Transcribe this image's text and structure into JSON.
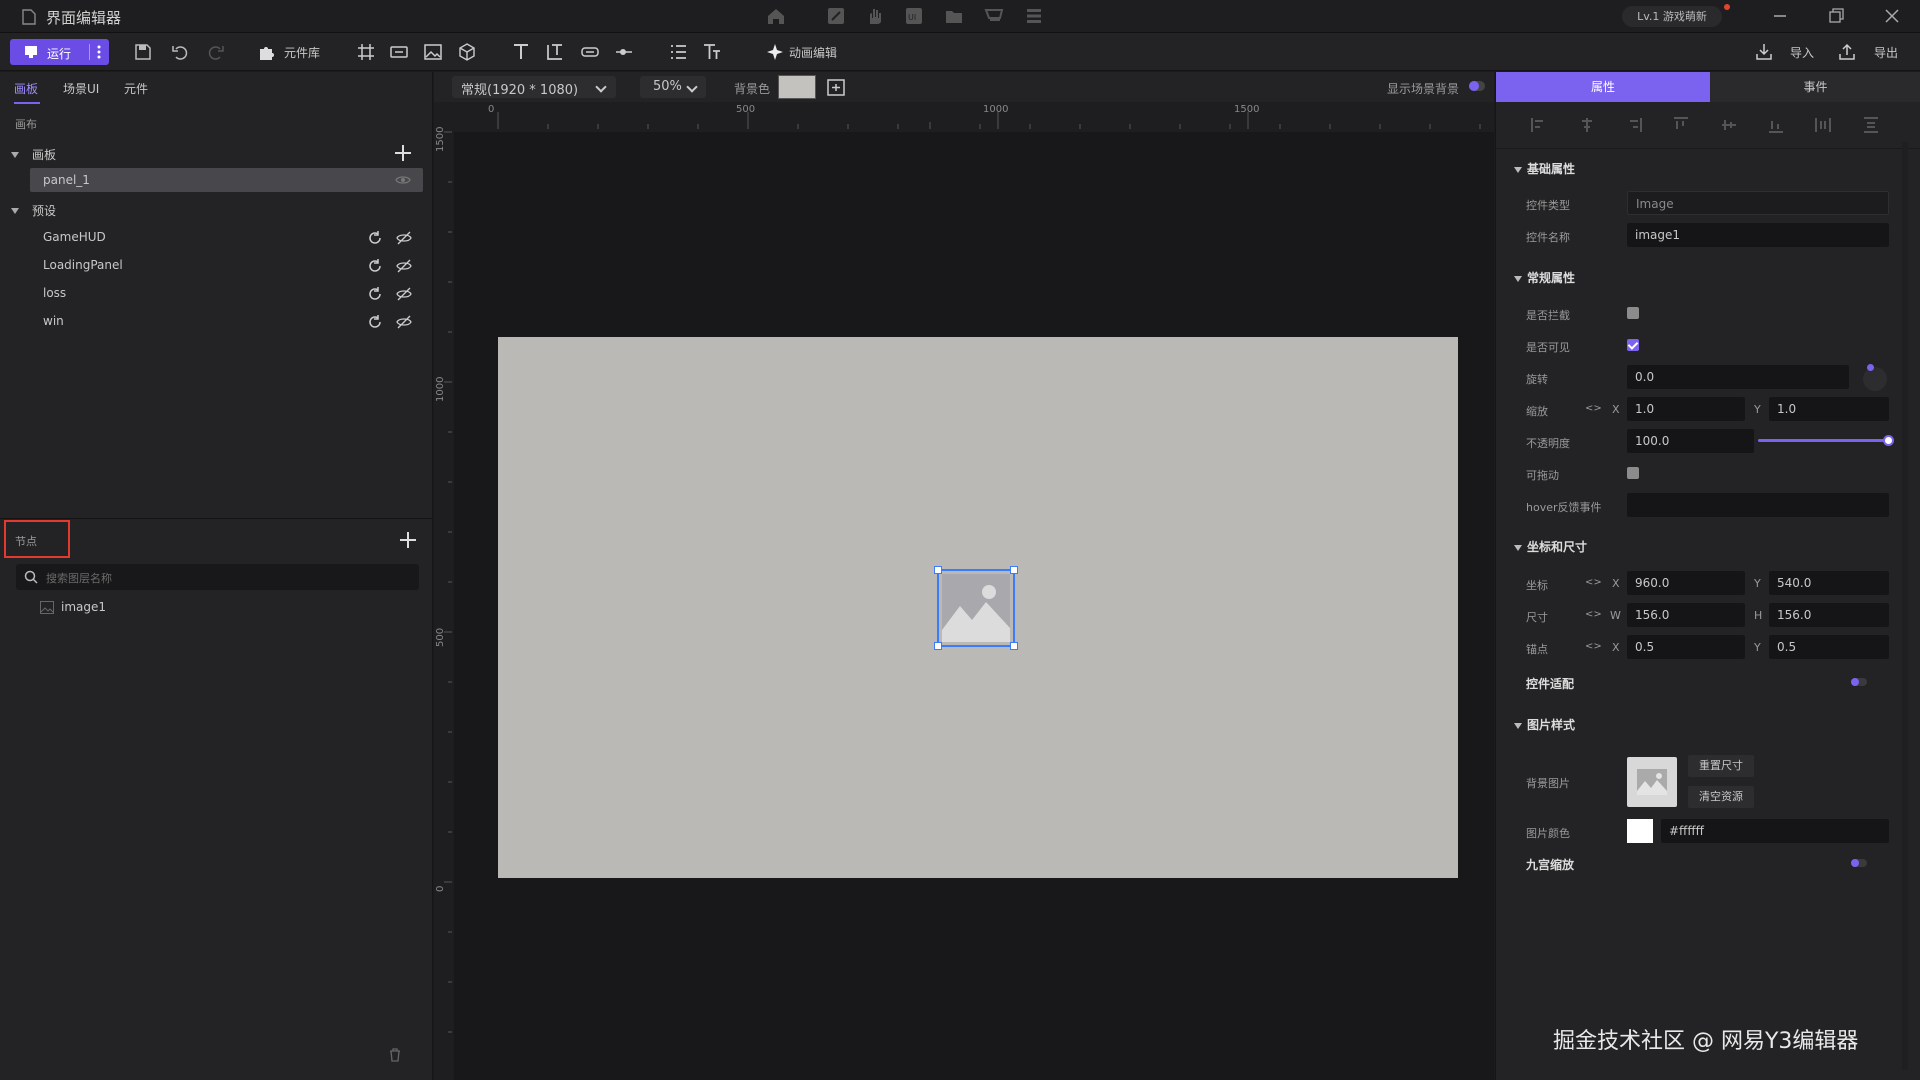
{
  "window": {
    "title": "界面编辑器",
    "level_badge": "Lv.1 游戏萌新"
  },
  "toolbar": {
    "run_label": "运行",
    "components_label": "元件库",
    "anim_label": "动画编辑",
    "import_label": "导入",
    "export_label": "导出"
  },
  "left": {
    "tabs": [
      "画板",
      "场景UI",
      "元件"
    ],
    "canvas_section": "画布",
    "boards_label": "画板",
    "panel_item": "panel_1",
    "presets_label": "预设",
    "presets": [
      "GameHUD",
      "LoadingPanel",
      "loss",
      "win"
    ],
    "nodes_label": "节点",
    "search_placeholder": "搜索图层名称",
    "node_items": [
      "image1"
    ]
  },
  "center": {
    "resolution": "常规(1920 * 1080)",
    "zoom": "50%",
    "bg_color_label": "背景色",
    "show_scene_bg_label": "显示场景背景",
    "hruler_ticks": [
      "0",
      "500",
      "1000",
      "1500"
    ],
    "vruler_ticks": [
      "1500",
      "1000",
      "500",
      "0"
    ]
  },
  "right": {
    "tabs": {
      "properties": "属性",
      "events": "事件"
    },
    "basic_section": "基础属性",
    "control_type_label": "控件类型",
    "control_type_value": "Image",
    "control_name_label": "控件名称",
    "control_name_value": "image1",
    "general_section": "常规属性",
    "intercept_label": "是否拦截",
    "visible_label": "是否可见",
    "rotation_label": "旋转",
    "rotation_value": "0.0",
    "scale_label": "缩放",
    "scale_x": "1.0",
    "scale_y": "1.0",
    "opacity_label": "不透明度",
    "opacity_value": "100.0",
    "draggable_label": "可拖动",
    "hover_label": "hover反馈事件",
    "coord_section": "坐标和尺寸",
    "pos_label": "坐标",
    "pos_x": "960.0",
    "pos_y": "540.0",
    "size_label": "尺寸",
    "size_w": "156.0",
    "size_h": "156.0",
    "anchor_label": "锚点",
    "anchor_x": "0.5",
    "anchor_y": "0.5",
    "adapt_label": "控件适配",
    "image_section": "图片样式",
    "bg_image_label": "背景图片",
    "reset_size_btn": "重置尺寸",
    "clear_res_btn": "清空资源",
    "image_color_label": "图片颜色",
    "image_color_value": "#ffffff",
    "nine_slice_label": "九宫缩放",
    "axis_x": "X",
    "axis_y": "Y",
    "axis_w": "W",
    "axis_h": "H",
    "link_glyph": "<>"
  },
  "watermark": "掘金技术社区 @ 网易Y3编辑器",
  "colors": {
    "accent": "#7b63f0",
    "canvas": "#bbb9b5",
    "selection": "#3b7cff"
  }
}
